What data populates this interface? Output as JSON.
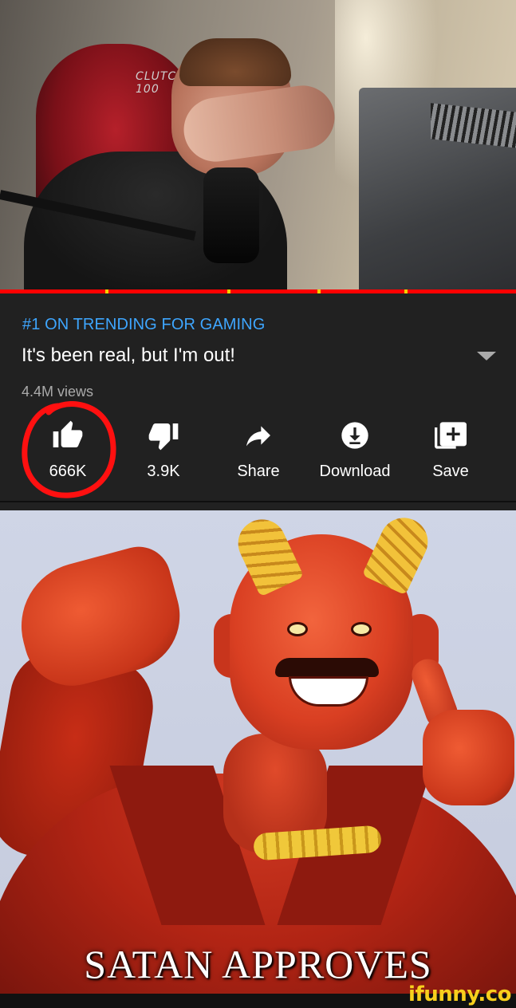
{
  "video": {
    "chair_brand": "CLUTCH",
    "chair_model": "100",
    "progress": 1.0,
    "accent_color": "#ff0000"
  },
  "info": {
    "trending_label": "#1 ON TRENDING FOR GAMING",
    "title": "It's been real, but I'm out!",
    "views": "4.4M views",
    "trending_color": "#3ea6ff"
  },
  "actions": [
    {
      "icon": "thumbs-up-icon",
      "label": "666K"
    },
    {
      "icon": "thumbs-down-icon",
      "label": "3.9K"
    },
    {
      "icon": "share-icon",
      "label": "Share"
    },
    {
      "icon": "download-icon",
      "label": "Download"
    },
    {
      "icon": "save-playlist-icon",
      "label": "Save"
    }
  ],
  "meme": {
    "caption": "SATAN APPROVES"
  },
  "watermark": "ifunny.co"
}
